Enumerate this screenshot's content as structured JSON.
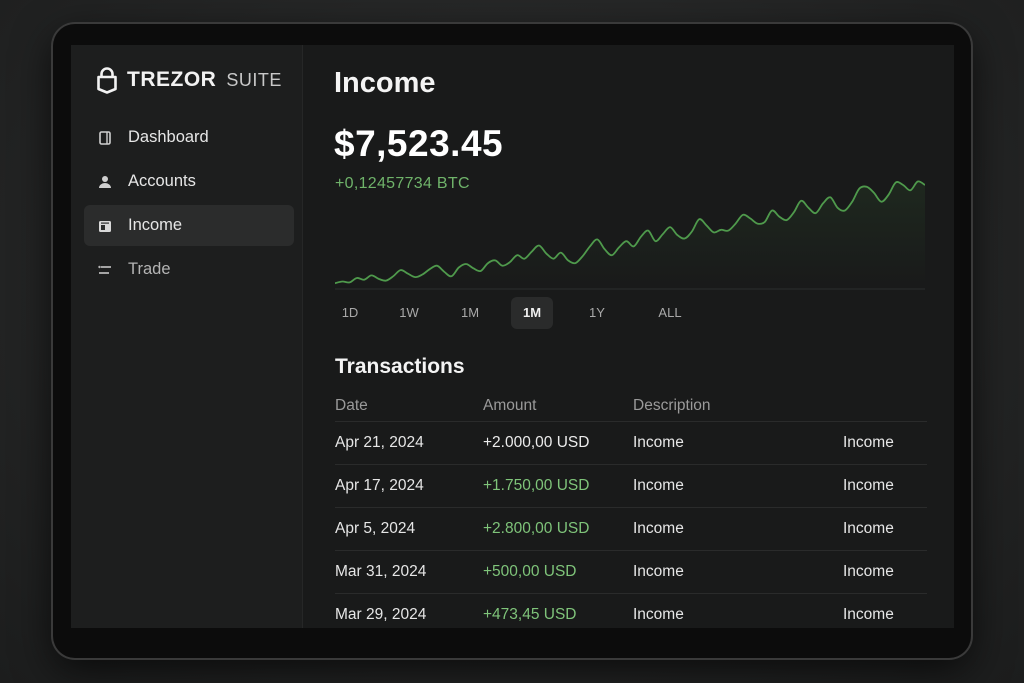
{
  "app": {
    "brand": "TREZOR",
    "brand_suffix": "SUITE"
  },
  "sidebar": {
    "items": [
      {
        "label": "Dashboard",
        "icon": "wallet-icon",
        "active": false
      },
      {
        "label": "Accounts",
        "icon": "user-icon",
        "active": false
      },
      {
        "label": "Income",
        "icon": "income-icon",
        "active": true
      },
      {
        "label": "Trade",
        "icon": "trade-icon",
        "active": false
      }
    ]
  },
  "main": {
    "title": "Income",
    "balance": "$7,523.45",
    "btc_change": "+0,12457734 BTC",
    "ranges": [
      "1D",
      "1W",
      "1M",
      "1M",
      "1Y",
      "ALL"
    ],
    "active_range_index": 3
  },
  "chart_data": {
    "type": "area",
    "values": [
      2,
      4,
      3,
      8,
      6,
      11,
      7,
      5,
      10,
      17,
      13,
      9,
      12,
      18,
      22,
      15,
      10,
      20,
      24,
      19,
      16,
      25,
      28,
      22,
      26,
      34,
      30,
      38,
      45,
      36,
      30,
      37,
      28,
      25,
      33,
      44,
      52,
      41,
      34,
      43,
      50,
      44,
      55,
      62,
      50,
      58,
      66,
      57,
      53,
      61,
      75,
      68,
      60,
      63,
      62,
      70,
      80,
      76,
      70,
      72,
      85,
      78,
      74,
      83,
      96,
      88,
      82,
      93,
      100,
      88,
      85,
      95,
      110,
      112,
      105,
      95,
      103,
      117,
      114,
      108,
      118,
      114
    ],
    "ylim": [
      0,
      130
    ],
    "colors": {
      "line": "#4f9a4c",
      "fill": "#1f2a1f"
    }
  },
  "transactions": {
    "title": "Transactions",
    "headers": {
      "date": "Date",
      "amount": "Amount",
      "description": "Description"
    },
    "rows": [
      {
        "date": "Apr 21, 2024",
        "amount": "+2.000,00 USD",
        "description": "Income",
        "category": "Income",
        "highlight": false
      },
      {
        "date": "Apr 17, 2024",
        "amount": "+1.750,00 USD",
        "description": "Income",
        "category": "Income",
        "highlight": true
      },
      {
        "date": "Apr 5, 2024",
        "amount": "+2.800,00 USD",
        "description": "Income",
        "category": "Income",
        "highlight": true
      },
      {
        "date": "Mar 31, 2024",
        "amount": "+500,00 USD",
        "description": "Income",
        "category": "Income",
        "highlight": true
      },
      {
        "date": "Mar 29, 2024",
        "amount": "+473,45 USD",
        "description": "Income",
        "category": "Income",
        "highlight": true
      }
    ]
  }
}
